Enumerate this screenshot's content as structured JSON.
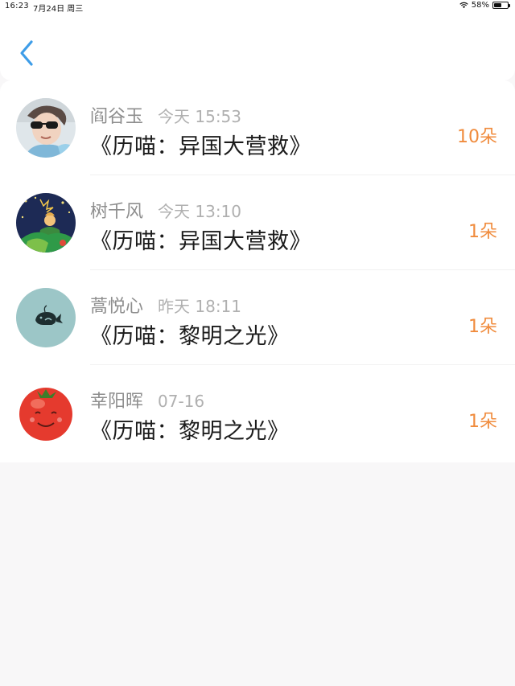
{
  "status_bar": {
    "time": "16:23",
    "date": "7月24日 周三",
    "battery": "58%",
    "battery_level": 0.58
  },
  "nav": {
    "back_icon": "chevron-left-icon",
    "accent_color": "#3e9de8"
  },
  "list": {
    "items": [
      {
        "name": "阎谷玉",
        "time": "今天 15:53",
        "title": "《历喵：异国大营救》",
        "count": "10朵",
        "avatar": "avatar-boy-sunglasses"
      },
      {
        "name": "树千风",
        "time": "今天 13:10",
        "title": "《历喵：异国大营救》",
        "count": "1朵",
        "avatar": "avatar-little-prince"
      },
      {
        "name": "蒿悦心",
        "time": "昨天 18:11",
        "title": "《历喵：黎明之光》",
        "count": "1朵",
        "avatar": "avatar-whale"
      },
      {
        "name": "幸阳晖",
        "time": "07-16",
        "title": "《历喵：黎明之光》",
        "count": "1朵",
        "avatar": "avatar-tomato"
      }
    ]
  },
  "colors": {
    "name_text": "#8e8e8e",
    "time_text": "#b0b0b0",
    "title_text": "#1b1b1b",
    "count_text": "#f08b3c",
    "background": "#f8f7f8"
  }
}
